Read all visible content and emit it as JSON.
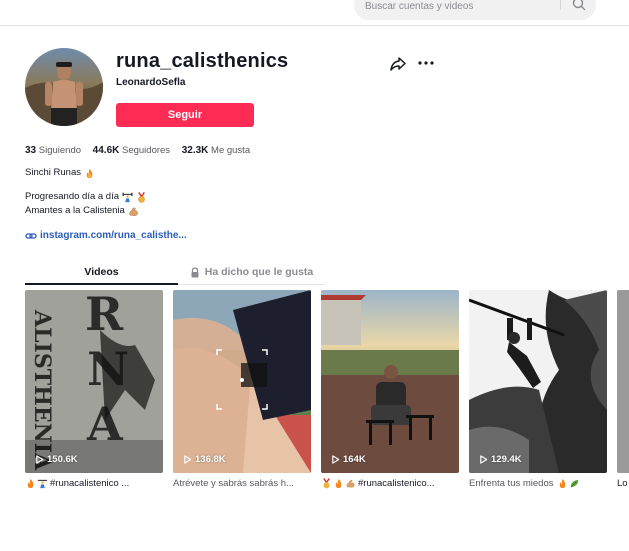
{
  "search": {
    "placeholder": "Buscar cuentas y videos",
    "icon": "search-icon"
  },
  "profile": {
    "username": "runa_calisthenics",
    "nickname": "LeonardoSefla",
    "follow_label": "Seguir",
    "stats": [
      {
        "value": "33",
        "label": "Siguiendo"
      },
      {
        "value": "44.6K",
        "label": "Seguidores"
      },
      {
        "value": "32.3K",
        "label": "Me gusta"
      }
    ],
    "bio": {
      "line1": "Sinchi Runas",
      "line2": "Progresando día a día",
      "line3": "Amantes a la Calistenia"
    },
    "link": "instagram.com/runa_calisthe..."
  },
  "tabs": {
    "videos": "Videos",
    "liked": "Ha dicho que le gusta"
  },
  "videos": [
    {
      "views": "150.6K",
      "caption": "#runacalistenico ..."
    },
    {
      "views": "136.8K",
      "caption": "Atrévete y sabrás sabrás h..."
    },
    {
      "views": "164K",
      "caption": "#runacalistenico..."
    },
    {
      "views": "129.4K",
      "caption": "Enfrenta tus miedos"
    },
    {
      "views": "",
      "caption": "Lo"
    }
  ],
  "colors": {
    "accent": "#fe2c55",
    "link": "#2b5db9",
    "text": "#161823",
    "muted": "#8a8b91"
  }
}
